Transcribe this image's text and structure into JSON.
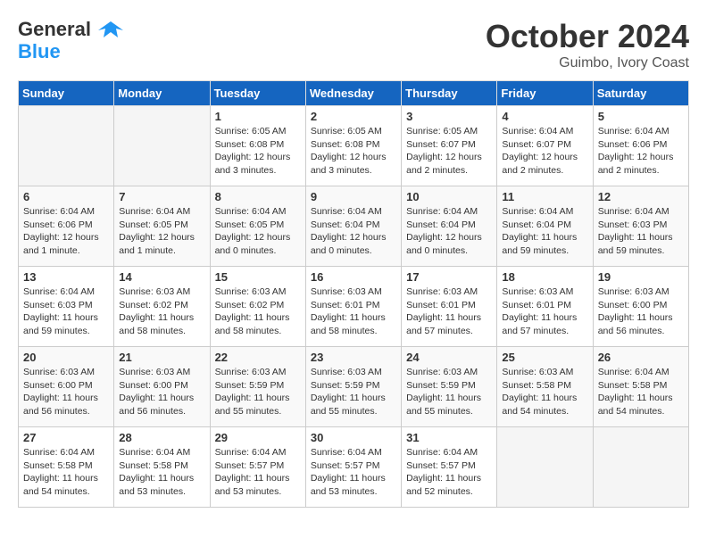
{
  "header": {
    "logo_line1": "General",
    "logo_line2": "Blue",
    "month_title": "October 2024",
    "location": "Guimbo, Ivory Coast"
  },
  "weekdays": [
    "Sunday",
    "Monday",
    "Tuesday",
    "Wednesday",
    "Thursday",
    "Friday",
    "Saturday"
  ],
  "weeks": [
    [
      {
        "day": "",
        "info": ""
      },
      {
        "day": "",
        "info": ""
      },
      {
        "day": "1",
        "info": "Sunrise: 6:05 AM\nSunset: 6:08 PM\nDaylight: 12 hours\nand 3 minutes."
      },
      {
        "day": "2",
        "info": "Sunrise: 6:05 AM\nSunset: 6:08 PM\nDaylight: 12 hours\nand 3 minutes."
      },
      {
        "day": "3",
        "info": "Sunrise: 6:05 AM\nSunset: 6:07 PM\nDaylight: 12 hours\nand 2 minutes."
      },
      {
        "day": "4",
        "info": "Sunrise: 6:04 AM\nSunset: 6:07 PM\nDaylight: 12 hours\nand 2 minutes."
      },
      {
        "day": "5",
        "info": "Sunrise: 6:04 AM\nSunset: 6:06 PM\nDaylight: 12 hours\nand 2 minutes."
      }
    ],
    [
      {
        "day": "6",
        "info": "Sunrise: 6:04 AM\nSunset: 6:06 PM\nDaylight: 12 hours\nand 1 minute."
      },
      {
        "day": "7",
        "info": "Sunrise: 6:04 AM\nSunset: 6:05 PM\nDaylight: 12 hours\nand 1 minute."
      },
      {
        "day": "8",
        "info": "Sunrise: 6:04 AM\nSunset: 6:05 PM\nDaylight: 12 hours\nand 0 minutes."
      },
      {
        "day": "9",
        "info": "Sunrise: 6:04 AM\nSunset: 6:04 PM\nDaylight: 12 hours\nand 0 minutes."
      },
      {
        "day": "10",
        "info": "Sunrise: 6:04 AM\nSunset: 6:04 PM\nDaylight: 12 hours\nand 0 minutes."
      },
      {
        "day": "11",
        "info": "Sunrise: 6:04 AM\nSunset: 6:04 PM\nDaylight: 11 hours\nand 59 minutes."
      },
      {
        "day": "12",
        "info": "Sunrise: 6:04 AM\nSunset: 6:03 PM\nDaylight: 11 hours\nand 59 minutes."
      }
    ],
    [
      {
        "day": "13",
        "info": "Sunrise: 6:04 AM\nSunset: 6:03 PM\nDaylight: 11 hours\nand 59 minutes."
      },
      {
        "day": "14",
        "info": "Sunrise: 6:03 AM\nSunset: 6:02 PM\nDaylight: 11 hours\nand 58 minutes."
      },
      {
        "day": "15",
        "info": "Sunrise: 6:03 AM\nSunset: 6:02 PM\nDaylight: 11 hours\nand 58 minutes."
      },
      {
        "day": "16",
        "info": "Sunrise: 6:03 AM\nSunset: 6:01 PM\nDaylight: 11 hours\nand 58 minutes."
      },
      {
        "day": "17",
        "info": "Sunrise: 6:03 AM\nSunset: 6:01 PM\nDaylight: 11 hours\nand 57 minutes."
      },
      {
        "day": "18",
        "info": "Sunrise: 6:03 AM\nSunset: 6:01 PM\nDaylight: 11 hours\nand 57 minutes."
      },
      {
        "day": "19",
        "info": "Sunrise: 6:03 AM\nSunset: 6:00 PM\nDaylight: 11 hours\nand 56 minutes."
      }
    ],
    [
      {
        "day": "20",
        "info": "Sunrise: 6:03 AM\nSunset: 6:00 PM\nDaylight: 11 hours\nand 56 minutes."
      },
      {
        "day": "21",
        "info": "Sunrise: 6:03 AM\nSunset: 6:00 PM\nDaylight: 11 hours\nand 56 minutes."
      },
      {
        "day": "22",
        "info": "Sunrise: 6:03 AM\nSunset: 5:59 PM\nDaylight: 11 hours\nand 55 minutes."
      },
      {
        "day": "23",
        "info": "Sunrise: 6:03 AM\nSunset: 5:59 PM\nDaylight: 11 hours\nand 55 minutes."
      },
      {
        "day": "24",
        "info": "Sunrise: 6:03 AM\nSunset: 5:59 PM\nDaylight: 11 hours\nand 55 minutes."
      },
      {
        "day": "25",
        "info": "Sunrise: 6:03 AM\nSunset: 5:58 PM\nDaylight: 11 hours\nand 54 minutes."
      },
      {
        "day": "26",
        "info": "Sunrise: 6:04 AM\nSunset: 5:58 PM\nDaylight: 11 hours\nand 54 minutes."
      }
    ],
    [
      {
        "day": "27",
        "info": "Sunrise: 6:04 AM\nSunset: 5:58 PM\nDaylight: 11 hours\nand 54 minutes."
      },
      {
        "day": "28",
        "info": "Sunrise: 6:04 AM\nSunset: 5:58 PM\nDaylight: 11 hours\nand 53 minutes."
      },
      {
        "day": "29",
        "info": "Sunrise: 6:04 AM\nSunset: 5:57 PM\nDaylight: 11 hours\nand 53 minutes."
      },
      {
        "day": "30",
        "info": "Sunrise: 6:04 AM\nSunset: 5:57 PM\nDaylight: 11 hours\nand 53 minutes."
      },
      {
        "day": "31",
        "info": "Sunrise: 6:04 AM\nSunset: 5:57 PM\nDaylight: 11 hours\nand 52 minutes."
      },
      {
        "day": "",
        "info": ""
      },
      {
        "day": "",
        "info": ""
      }
    ]
  ]
}
